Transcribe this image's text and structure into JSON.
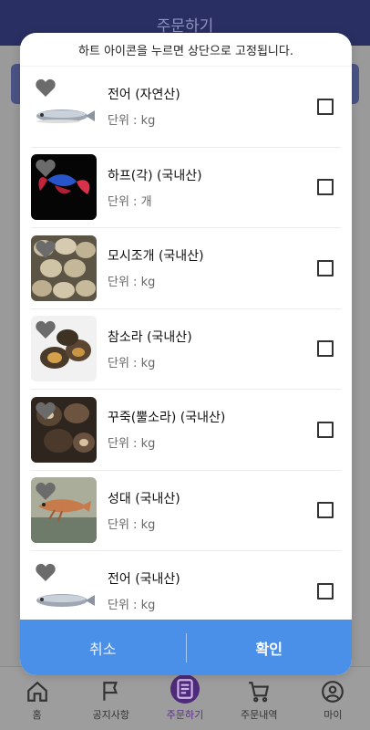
{
  "app": {
    "title": "주문하기"
  },
  "modal": {
    "notice": "하트 아이콘을 누르면 상단으로 고정됩니다.",
    "items": [
      {
        "name": "전어 (자연산)",
        "unit": "단위 : kg",
        "image": "fish-gizzard-shad"
      },
      {
        "name": "하프(각) (국내산)",
        "unit": "단위 : 개",
        "image": "betta-fish"
      },
      {
        "name": "모시조개 (국내산)",
        "unit": "단위 : kg",
        "image": "clams"
      },
      {
        "name": "참소라 (국내산)",
        "unit": "단위 : kg",
        "image": "sea-snail"
      },
      {
        "name": "꾸죽(뿔소라) (국내산)",
        "unit": "단위 : kg",
        "image": "horned-turban"
      },
      {
        "name": "성대 (국내산)",
        "unit": "단위 : kg",
        "image": "gurnard-fish"
      },
      {
        "name": "전어 (국내산)",
        "unit": "단위 : kg",
        "image": "fish-gizzard-shad"
      }
    ],
    "cancel_label": "취소",
    "confirm_label": "확인"
  },
  "nav": [
    {
      "label": "홈",
      "icon": "home-icon"
    },
    {
      "label": "공지사항",
      "icon": "flag-icon"
    },
    {
      "label": "주문하기",
      "icon": "order-icon"
    },
    {
      "label": "주문내역",
      "icon": "cart-icon"
    },
    {
      "label": "마이",
      "icon": "user-icon"
    }
  ],
  "colors": {
    "header": "#2a2f63",
    "footer": "#4a90e8",
    "active_nav": "#4e2a7a"
  }
}
